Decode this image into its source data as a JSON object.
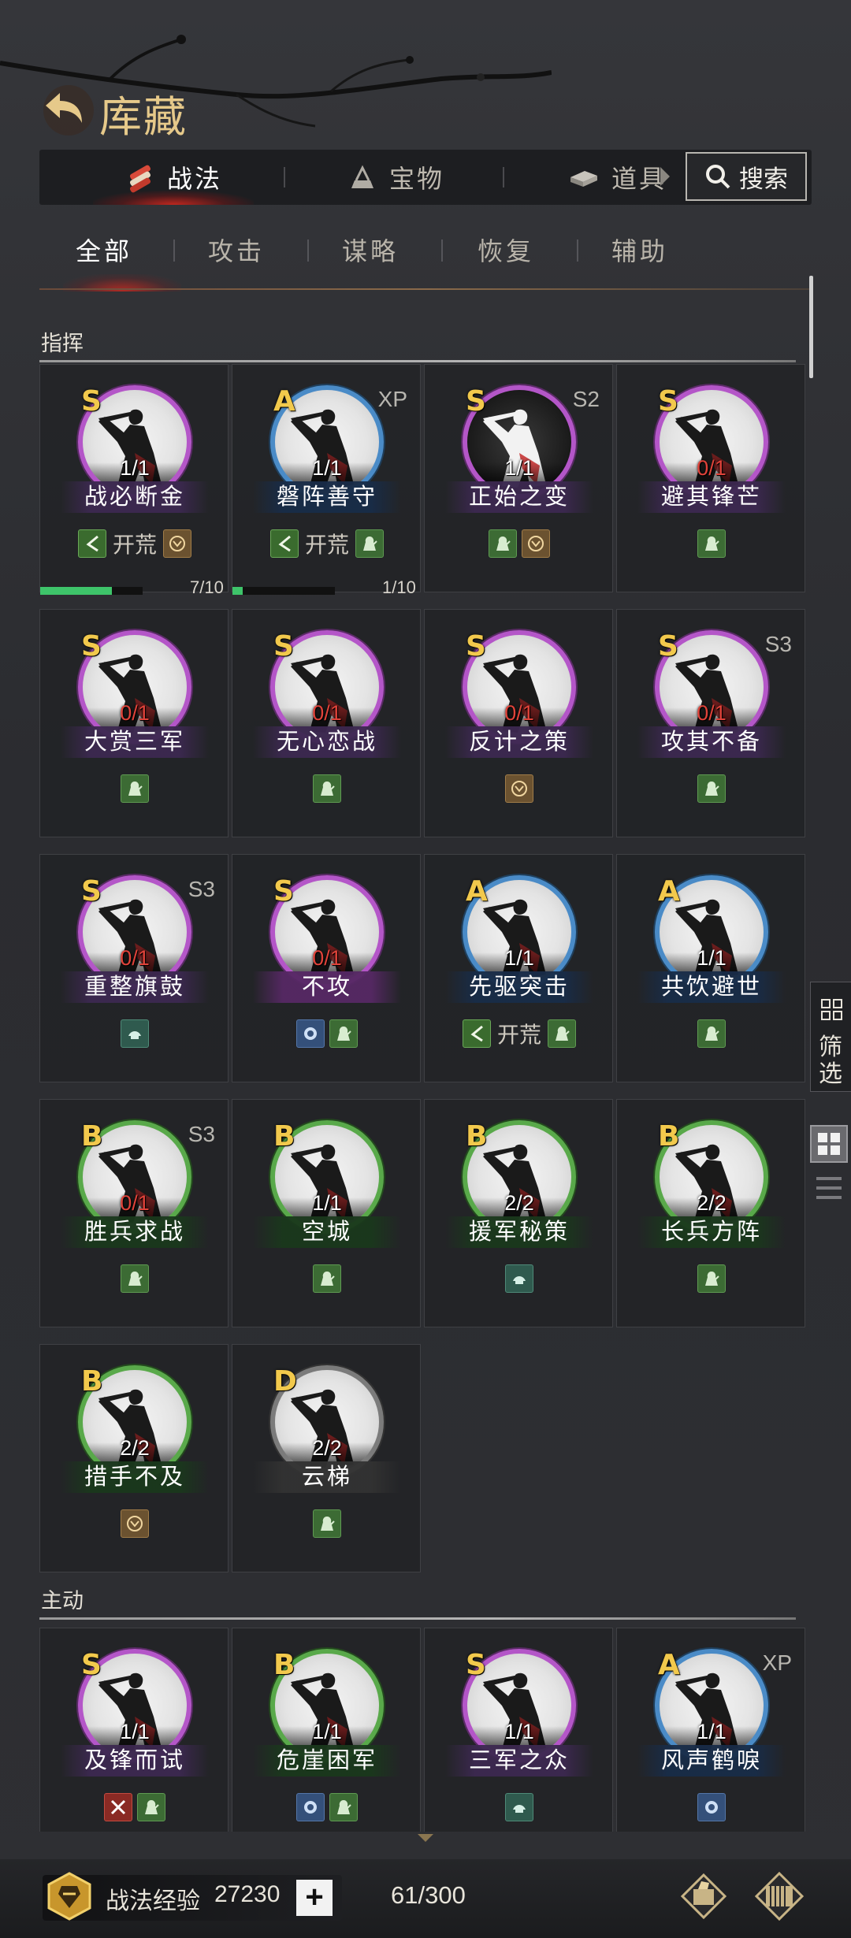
{
  "header": {
    "title": "库藏"
  },
  "main_tabs": [
    {
      "label": "战法",
      "icon": "scroll-bundle-icon",
      "active": true
    },
    {
      "label": "宝物",
      "icon": "treasure-icon",
      "active": false
    },
    {
      "label": "道具",
      "icon": "item-icon",
      "active": false
    }
  ],
  "search": {
    "label": "搜索"
  },
  "sub_tabs": [
    {
      "label": "全部",
      "active": true
    },
    {
      "label": "攻击",
      "active": false
    },
    {
      "label": "谋略",
      "active": false
    },
    {
      "label": "恢复",
      "active": false
    },
    {
      "label": "辅助",
      "active": false
    }
  ],
  "sections": [
    {
      "title": "指挥"
    },
    {
      "title": "主动"
    }
  ],
  "cards": [
    {
      "grade": "S",
      "tag": "",
      "count": "1/1",
      "red": false,
      "name": "战必断金",
      "badges": [
        "kh",
        "brown"
      ],
      "kh_label": "开荒",
      "progress": {
        "value": 7,
        "max": 10,
        "label": "7/10"
      }
    },
    {
      "grade": "A",
      "tag": "XP",
      "count": "1/1",
      "red": false,
      "name": "磐阵善守",
      "badges": [
        "kh",
        "green"
      ],
      "kh_label": "开荒",
      "progress": {
        "value": 1,
        "max": 10,
        "label": "1/10"
      }
    },
    {
      "grade": "S",
      "tag": "S2",
      "count": "1/1",
      "red": false,
      "name": "正始之变",
      "badges": [
        "green",
        "brown"
      ],
      "dark": true
    },
    {
      "grade": "S",
      "tag": "",
      "count": "0/1",
      "red": true,
      "name": "避其锋芒",
      "badges": [
        "green"
      ]
    },
    {
      "grade": "S",
      "tag": "",
      "count": "0/1",
      "red": true,
      "name": "大赏三军",
      "badges": [
        "green"
      ]
    },
    {
      "grade": "S",
      "tag": "",
      "count": "0/1",
      "red": true,
      "name": "无心恋战",
      "badges": [
        "green"
      ]
    },
    {
      "grade": "S",
      "tag": "",
      "count": "0/1",
      "red": true,
      "name": "反计之策",
      "badges": [
        "brown"
      ]
    },
    {
      "grade": "S",
      "tag": "S3",
      "count": "0/1",
      "red": true,
      "name": "攻其不备",
      "badges": [
        "green"
      ]
    },
    {
      "grade": "S",
      "tag": "S3",
      "count": "0/1",
      "red": true,
      "name": "重整旗鼓",
      "badges": [
        "teal"
      ]
    },
    {
      "grade": "S",
      "tag": "",
      "count": "0/1",
      "red": true,
      "name": "不攻",
      "badges": [
        "blue",
        "green"
      ],
      "nameStyle": "P"
    },
    {
      "grade": "A",
      "tag": "",
      "count": "1/1",
      "red": false,
      "name": "先驱突击",
      "badges": [
        "kh",
        "green"
      ],
      "kh_label": "开荒"
    },
    {
      "grade": "A",
      "tag": "",
      "count": "1/1",
      "red": false,
      "name": "共饮避世",
      "badges": [
        "green"
      ]
    },
    {
      "grade": "B",
      "tag": "S3",
      "count": "0/1",
      "red": true,
      "name": "胜兵求战",
      "badges": [
        "green"
      ]
    },
    {
      "grade": "B",
      "tag": "",
      "count": "1/1",
      "red": false,
      "name": "空城",
      "badges": [
        "green"
      ]
    },
    {
      "grade": "B",
      "tag": "",
      "count": "2/2",
      "red": false,
      "name": "援军秘策",
      "badges": [
        "teal"
      ]
    },
    {
      "grade": "B",
      "tag": "",
      "count": "2/2",
      "red": false,
      "name": "长兵方阵",
      "badges": [
        "green"
      ]
    },
    {
      "grade": "B",
      "tag": "",
      "count": "2/2",
      "red": false,
      "name": "措手不及",
      "badges": [
        "brown"
      ]
    },
    {
      "grade": "D",
      "tag": "",
      "count": "2/2",
      "red": false,
      "name": "云梯",
      "badges": [
        "green"
      ]
    },
    {
      "grade": "S",
      "tag": "",
      "count": "1/1",
      "red": false,
      "name": "及锋而试",
      "badges": [
        "red",
        "green"
      ]
    },
    {
      "grade": "B",
      "tag": "",
      "count": "1/1",
      "red": false,
      "name": "危崖困军",
      "badges": [
        "blue",
        "green"
      ]
    },
    {
      "grade": "S",
      "tag": "",
      "count": "1/1",
      "red": false,
      "name": "三军之众",
      "badges": [
        "teal"
      ]
    },
    {
      "grade": "A",
      "tag": "XP",
      "count": "1/1",
      "red": false,
      "name": "风声鹤唳",
      "badges": [
        "blue"
      ]
    }
  ],
  "side": {
    "filter_label": "筛选"
  },
  "bottom": {
    "exp_label": "战法经验",
    "exp_value": "27230",
    "plus": "+",
    "capacity": "61/300"
  },
  "colors": {
    "accent_gold": "#e6c98a",
    "grade_text": "#f2c94c",
    "count_red": "#e0433a",
    "progress": "#3ec46a"
  }
}
